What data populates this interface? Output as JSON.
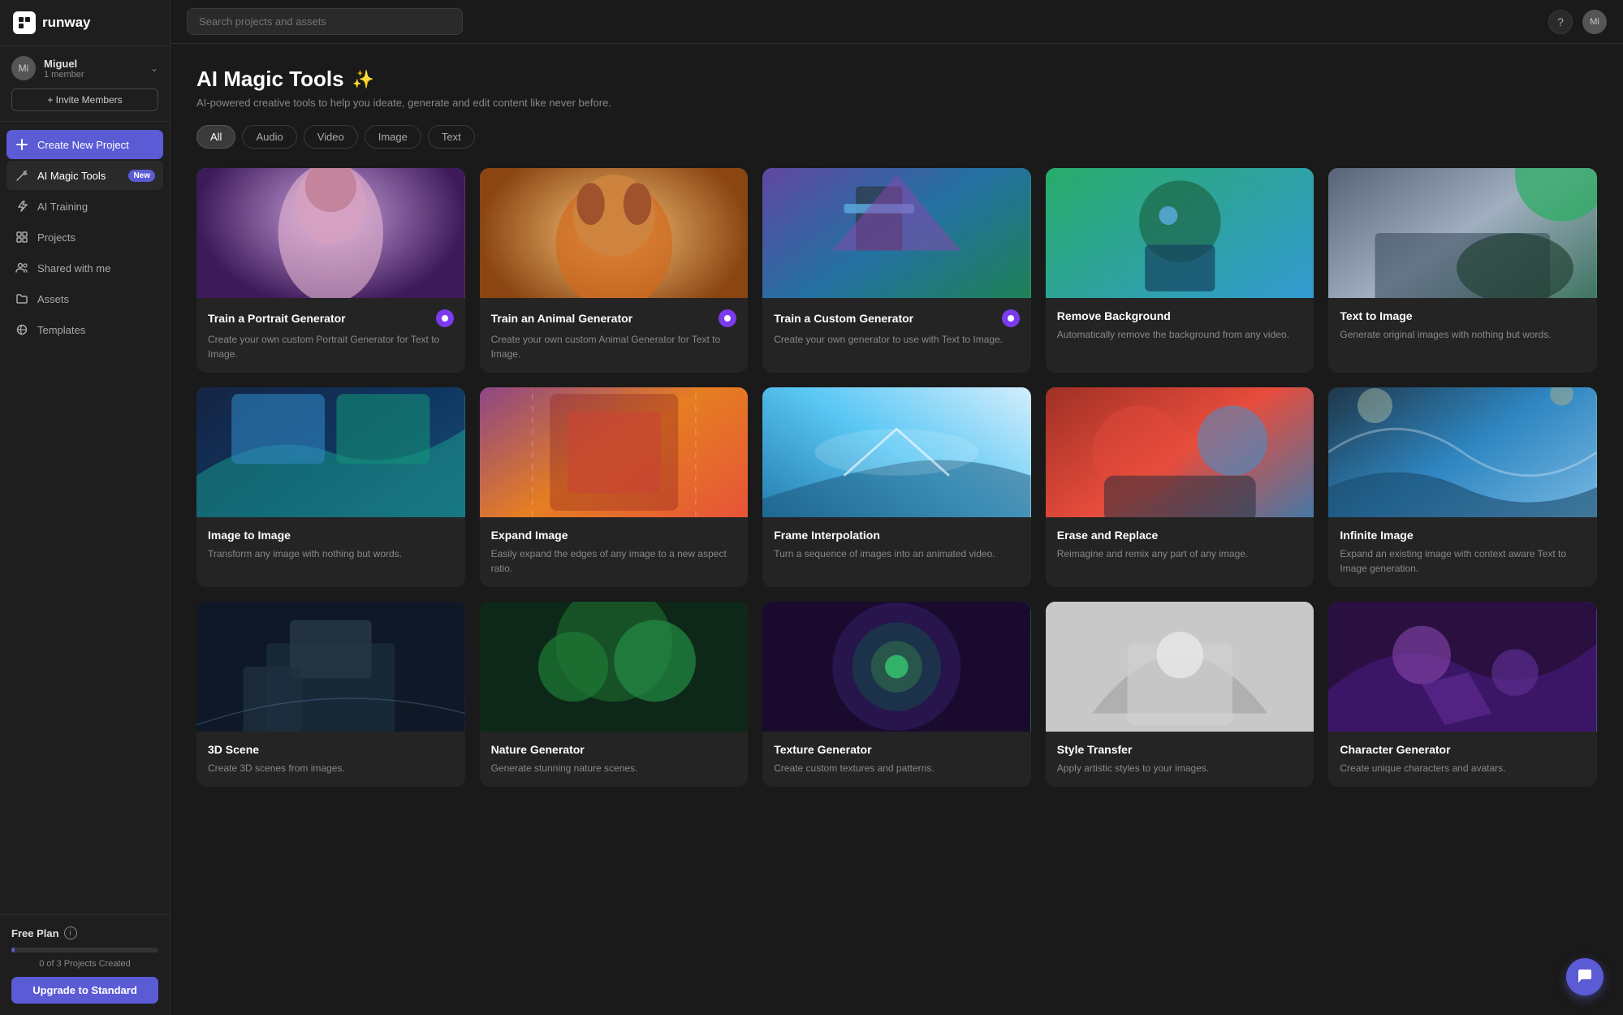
{
  "logo": {
    "icon": "R",
    "text": "runway"
  },
  "user": {
    "initials": "Mi",
    "name": "Miguel",
    "members": "1 member"
  },
  "invite_btn": "+ Invite Members",
  "nav": {
    "create": "Create New Project",
    "ai_magic_tools": "AI Magic Tools",
    "ai_magic_tools_badge": "New",
    "ai_training": "AI Training",
    "projects": "Projects",
    "shared_with_me": "Shared with me",
    "assets": "Assets",
    "templates": "Templates"
  },
  "footer": {
    "plan": "Free Plan",
    "projects_count": "0 of 3 Projects Created",
    "upgrade_btn": "Upgrade to Standard"
  },
  "topbar": {
    "search_placeholder": "Search projects and assets"
  },
  "page": {
    "title": "AI Magic Tools",
    "subtitle": "AI-powered creative tools to help you ideate, generate and edit content like never before."
  },
  "filters": [
    "All",
    "Audio",
    "Video",
    "Image",
    "Text"
  ],
  "active_filter": "All",
  "tools_row1": [
    {
      "title": "Train a Portrait Generator",
      "desc": "Create your own custom Portrait Generator for Text to Image.",
      "img_class": "img-portrait",
      "badge_bg": "#7c3aed"
    },
    {
      "title": "Train an Animal Generator",
      "desc": "Create your own custom Animal Generator for Text to Image.",
      "img_class": "img-animal",
      "badge_bg": "#7c3aed"
    },
    {
      "title": "Train a Custom Generator",
      "desc": "Create your own generator to use with Text to Image.",
      "img_class": "img-custom",
      "badge_bg": "#7c3aed"
    },
    {
      "title": "Remove Background",
      "desc": "Automatically remove the background from any video.",
      "img_class": "img-remove-bg",
      "badge_bg": null
    },
    {
      "title": "Text to Image",
      "desc": "Generate original images with nothing but words.",
      "img_class": "img-text-to-image",
      "badge_bg": null
    }
  ],
  "tools_row2": [
    {
      "title": "Image to Image",
      "desc": "Transform any image with nothing but words.",
      "img_class": "img-img-to-img",
      "badge_bg": null
    },
    {
      "title": "Expand Image",
      "desc": "Easily expand the edges of any image to a new aspect ratio.",
      "img_class": "img-expand",
      "badge_bg": null
    },
    {
      "title": "Frame Interpolation",
      "desc": "Turn a sequence of images into an animated video.",
      "img_class": "img-frame-interp",
      "badge_bg": null
    },
    {
      "title": "Erase and Replace",
      "desc": "Reimagine and remix any part of any image.",
      "img_class": "img-erase",
      "badge_bg": null
    },
    {
      "title": "Infinite Image",
      "desc": "Expand an existing image with context aware Text to Image generation.",
      "img_class": "img-infinite",
      "badge_bg": null
    }
  ],
  "tools_row3": [
    {
      "title": "3D Scene",
      "desc": "Create 3D scenes from images.",
      "img_class": "img-row3-1",
      "badge_bg": null
    },
    {
      "title": "Nature Generator",
      "desc": "Generate stunning nature scenes.",
      "img_class": "img-row3-2",
      "badge_bg": null
    },
    {
      "title": "Texture Generator",
      "desc": "Create custom textures and patterns.",
      "img_class": "img-row3-3",
      "badge_bg": null
    },
    {
      "title": "Style Transfer",
      "desc": "Apply artistic styles to your images.",
      "img_class": "img-row3-4",
      "badge_bg": null
    },
    {
      "title": "Character Generator",
      "desc": "Create unique characters and avatars.",
      "img_class": "img-row3-5",
      "badge_bg": null
    }
  ]
}
